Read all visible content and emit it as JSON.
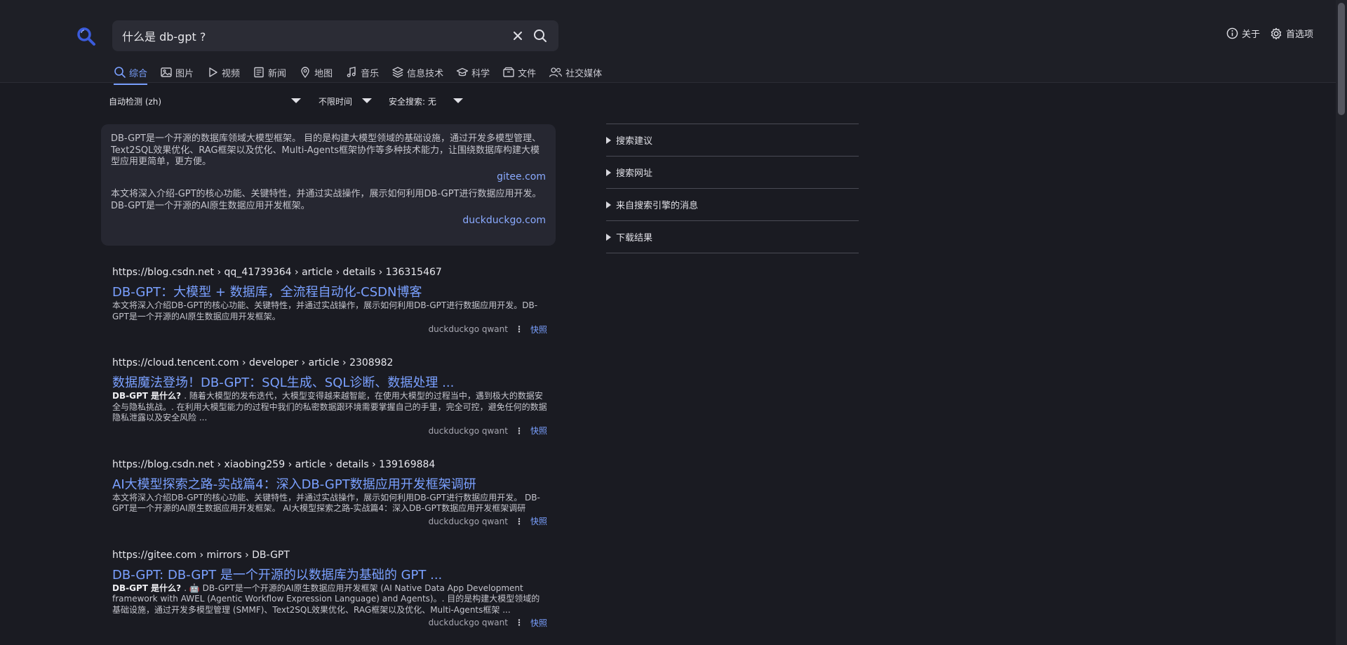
{
  "search": {
    "query": "什么是 db-gpt ?"
  },
  "top_links": [
    {
      "label": "关于",
      "icon": "info-icon"
    },
    {
      "label": "首选项",
      "icon": "gear-icon"
    }
  ],
  "tabs": [
    {
      "label": "综合",
      "icon": "search-icon",
      "active": true
    },
    {
      "label": "图片",
      "icon": "image-icon"
    },
    {
      "label": "视频",
      "icon": "play-icon"
    },
    {
      "label": "新闻",
      "icon": "newspaper-icon"
    },
    {
      "label": "地图",
      "icon": "map-pin-icon"
    },
    {
      "label": "音乐",
      "icon": "music-icon"
    },
    {
      "label": "信息技术",
      "icon": "layers-icon"
    },
    {
      "label": "科学",
      "icon": "graduation-cap-icon"
    },
    {
      "label": "文件",
      "icon": "box-icon"
    },
    {
      "label": "社交媒体",
      "icon": "people-icon"
    }
  ],
  "filters": {
    "language": "自动检测 (zh)",
    "time": "不限时间",
    "safe_search": "安全搜索: 无"
  },
  "answers": [
    {
      "text": "DB-GPT是一个开源的数据库领域大模型框架。 目的是构建大模型领域的基础设施，通过开发多模型管理、Text2SQL效果优化、RAG框架以及优化、Multi-Agents框架协作等多种技术能力，让围绕数据库构建大模型应用更简单，更方便。",
      "source": "gitee.com"
    },
    {
      "text": "本文将深入介绍-GPT的核心功能、关键特性，并通过实战操作，展示如何利用DB-GPT进行数据应用开发。DB-GPT是一个开源的AI原生数据应用开发框架。",
      "source": "duckduckgo.com"
    }
  ],
  "results": [
    {
      "domain": "https://blog.csdn.net",
      "path": " › qq_41739364 › article › details › 136315467",
      "title": "DB-GPT：大模型 + 数据库，全流程自动化-CSDN博客",
      "snippet_bold": "",
      "snippet": "本文将深入介绍DB-GPT的核心功能、关键特性，并通过实战操作，展示如何利用DB-GPT进行数据应用开发。DB-GPT是一个开源的AI原生数据应用开发框架。",
      "engines": "duckduckgo   qwant",
      "cache": "快照"
    },
    {
      "domain": "https://cloud.tencent.com",
      "path": " › developer › article › 2308982",
      "title": "数据魔法登场！DB-GPT：SQL生成、SQL诊断、数据处理 ...",
      "snippet_bold": "DB-GPT 是什么? ",
      "snippet": ". 随着大模型的发布迭代，大模型变得越来越智能，在使用大模型的过程当中，遇到极大的数据安全与隐私挑战。. 在利用大模型能力的过程中我们的私密数据跟环境需要掌握自己的手里，完全可控，避免任何的数据隐私泄露以及安全风险 ...",
      "engines": "duckduckgo   qwant",
      "cache": "快照"
    },
    {
      "domain": "https://blog.csdn.net",
      "path": " › xiaobing259 › article › details › 139169884",
      "title": "AI大模型探索之路-实战篇4：深入DB-GPT数据应用开发框架调研",
      "snippet_bold": "",
      "snippet": "本文将深入介绍DB-GPT的核心功能、关键特性，并通过实战操作，展示如何利用DB-GPT进行数据应用开发。 DB-GPT是一个开源的AI原生数据应用开发框架。 AI大模型探索之路-实战篇4：深入DB-GPT数据应用开发框架调研",
      "engines": "duckduckgo   qwant",
      "cache": "快照"
    },
    {
      "domain": "https://gitee.com",
      "path": " › mirrors › DB-GPT",
      "title": "DB-GPT: DB-GPT 是一个开源的以数据库为基础的 GPT ...",
      "snippet_bold": "DB-GPT 是什么? ",
      "snippet": ". 🤖 DB-GPT是一个开源的AI原生数据应用开发框架 (AI Native Data App Development framework with AWEL (Agentic Workflow Expression Language) and Agents)。. 目的是构建大模型领域的基础设施，通过开发多模型管理 (SMMF)、Text2SQL效果优化、RAG框架以及优化、Multi-Agents框架 ...",
      "engines": "duckduckgo   qwant",
      "cache": "快照"
    }
  ],
  "sidebar": [
    {
      "label": "搜索建议"
    },
    {
      "label": "搜索网址"
    },
    {
      "label": "来自搜索引擎的消息"
    },
    {
      "label": "下载结果"
    }
  ],
  "colors": {
    "accent": "#7aa0ff",
    "logo": "#3b5bdb",
    "background": "#1a1b22"
  }
}
